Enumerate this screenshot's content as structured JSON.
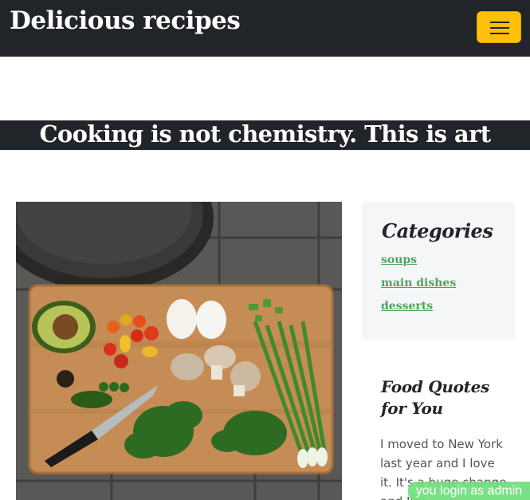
{
  "navbar": {
    "brand": "Delicious recipes",
    "toggler_color": "#ffc107"
  },
  "hero": {
    "banner_text": "Cooking is not chemistry. This is art"
  },
  "main": {
    "photo_icon": "cutting-board-vegetables-photo"
  },
  "sidebar": {
    "categories": {
      "title": "Categories",
      "items": [
        {
          "label": "soups"
        },
        {
          "label": "main dishes"
        },
        {
          "label": "desserts"
        }
      ]
    },
    "quotes": {
      "title": "Food Quotes for You",
      "text": "I moved to New York last year and I love it. It's a huge change and I've"
    }
  },
  "status": {
    "login_message": "you login as admin"
  },
  "colors": {
    "navbar_bg": "#212529",
    "link": "#4fa35f",
    "toast": "#6fe07a"
  }
}
